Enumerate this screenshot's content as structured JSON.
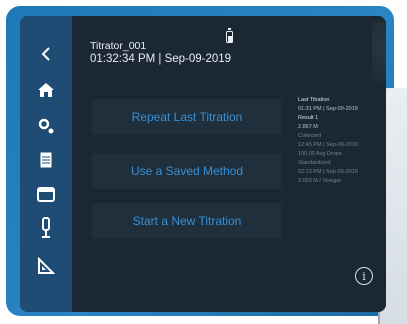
{
  "device": {
    "header_title": "Titrator_001",
    "header_datetime": "01:32:34 PM | Sep-09-2019"
  },
  "actions": [
    {
      "label": "Repeat Last Titration"
    },
    {
      "label": "Use a Saved Method"
    },
    {
      "label": "Start a New Titration"
    }
  ],
  "last_titration": {
    "heading": "Last Titration",
    "datetime": "01:31 PM | Sep-09-2019",
    "result_label": "Result 1",
    "result_value": "2.867 M",
    "line4": "Collected",
    "line5": "12:45 PM | Sep-09-2019",
    "line6": "100.00 Avg Drops",
    "line7": "Standardized",
    "line8": "02:13 PM | Sep-09-2019",
    "line9": "3.003 M / Vinegar"
  },
  "icons": {
    "back": "back-chevron-icon",
    "home": "home-icon",
    "settings": "gear-icon",
    "methods": "document-icon",
    "calendar": "calendar-icon",
    "probe": "probe-icon",
    "calibrate": "ruler-triangle-icon",
    "battery": "battery-icon",
    "info": "info-icon"
  },
  "colors": {
    "sidebar": "#1e4c75",
    "screen_bg": "#1b2833",
    "button_bg": "#1f2f3c",
    "button_text": "#3a8fd3",
    "device_shell": "#2a85c4"
  }
}
